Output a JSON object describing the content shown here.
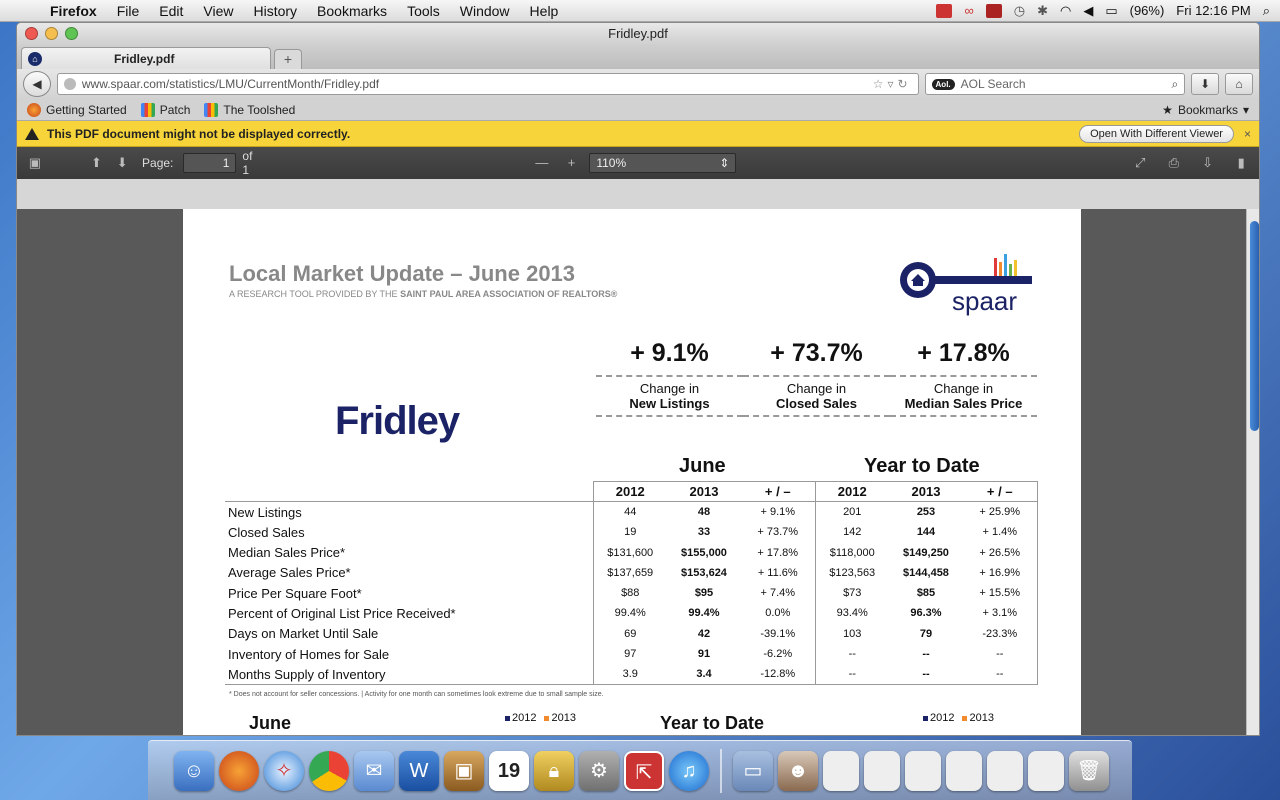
{
  "menubar": {
    "app": "Firefox",
    "items": [
      "File",
      "Edit",
      "View",
      "History",
      "Bookmarks",
      "Tools",
      "Window",
      "Help"
    ],
    "battery": "(96%)",
    "clock": "Fri 12:16 PM"
  },
  "window": {
    "title": "Fridley.pdf",
    "tab_title": "Fridley.pdf",
    "new_tab": "+",
    "url": "www.spaar.com/statistics/LMU/CurrentMonth/Fridley.pdf",
    "search_placeholder": "AOL Search",
    "search_badge": "Aol."
  },
  "bookmarks": {
    "items": [
      "Getting Started",
      "Patch",
      "The Toolshed"
    ],
    "menu": "Bookmarks"
  },
  "notification": {
    "message": "This PDF document might not be displayed correctly.",
    "button": "Open With Different Viewer",
    "close": "×"
  },
  "pdf_toolbar": {
    "page_label": "Page:",
    "page_value": "1",
    "page_total": "of 1",
    "zoom": "110%",
    "zoom_minus": "—",
    "zoom_plus": "+"
  },
  "report": {
    "title": "Local Market Update – June 2013",
    "subtitle_prefix": "A RESEARCH TOOL PROVIDED BY THE",
    "subtitle_org": "SAINT PAUL AREA ASSOCIATION OF REALTORS®",
    "logo_text": "spaar",
    "city": "Fridley",
    "kpis": [
      {
        "value": "+ 9.1%",
        "line1": "Change in",
        "line2": "New Listings"
      },
      {
        "value": "+ 73.7%",
        "line1": "Change in",
        "line2": "Closed Sales"
      },
      {
        "value": "+ 17.8%",
        "line1": "Change in",
        "line2": "Median Sales Price"
      }
    ],
    "period_june": "June",
    "period_ytd": "Year to Date",
    "columns": [
      "2012",
      "2013",
      "+ / –",
      "2012",
      "2013",
      "+ / –"
    ],
    "rows": [
      {
        "label": "New Listings",
        "vals": [
          "44",
          "48",
          "+ 9.1%",
          "201",
          "253",
          "+ 25.9%"
        ]
      },
      {
        "label": "Closed Sales",
        "vals": [
          "19",
          "33",
          "+ 73.7%",
          "142",
          "144",
          "+ 1.4%"
        ]
      },
      {
        "label": "Median Sales Price*",
        "vals": [
          "$131,600",
          "$155,000",
          "+ 17.8%",
          "$118,000",
          "$149,250",
          "+ 26.5%"
        ]
      },
      {
        "label": "Average Sales Price*",
        "vals": [
          "$137,659",
          "$153,624",
          "+ 11.6%",
          "$123,563",
          "$144,458",
          "+ 16.9%"
        ]
      },
      {
        "label": "Price Per Square Foot*",
        "vals": [
          "$88",
          "$95",
          "+ 7.4%",
          "$73",
          "$85",
          "+ 15.5%"
        ]
      },
      {
        "label": "Percent of Original List Price Received*",
        "vals": [
          "99.4%",
          "99.4%",
          "0.0%",
          "93.4%",
          "96.3%",
          "+ 3.1%"
        ]
      },
      {
        "label": "Days on Market Until Sale",
        "vals": [
          "69",
          "42",
          "-39.1%",
          "103",
          "79",
          "-23.3%"
        ]
      },
      {
        "label": "Inventory of Homes for Sale",
        "vals": [
          "97",
          "91",
          "-6.2%",
          "--",
          "--",
          "--"
        ]
      },
      {
        "label": "Months Supply of Inventory",
        "vals": [
          "3.9",
          "3.4",
          "-12.8%",
          "--",
          "--",
          "--"
        ]
      }
    ],
    "footnote": "* Does not account for seller concessions.  |  Activity for one month can sometimes look extreme due to small sample size.",
    "bottom_june": "June",
    "bottom_ytd": "Year to Date",
    "legend": [
      "2012",
      "2013"
    ]
  },
  "colors": {
    "brand_navy": "#1b2266",
    "accent_orange": "#f28a2e",
    "warning_yellow": "#f7d53a"
  },
  "dock": {
    "icons": [
      "finder-icon",
      "firefox-icon",
      "safari-icon",
      "chrome-icon",
      "mail-icon",
      "word-icon",
      "iphoto-icon",
      "calendar-icon",
      "keychain-icon",
      "system-preferences-icon",
      "app-icon",
      "itunes-icon",
      "folder-icon",
      "contact-icon",
      "window-thumbnail-icon",
      "trash-icon"
    ],
    "calendar_day": "19"
  }
}
